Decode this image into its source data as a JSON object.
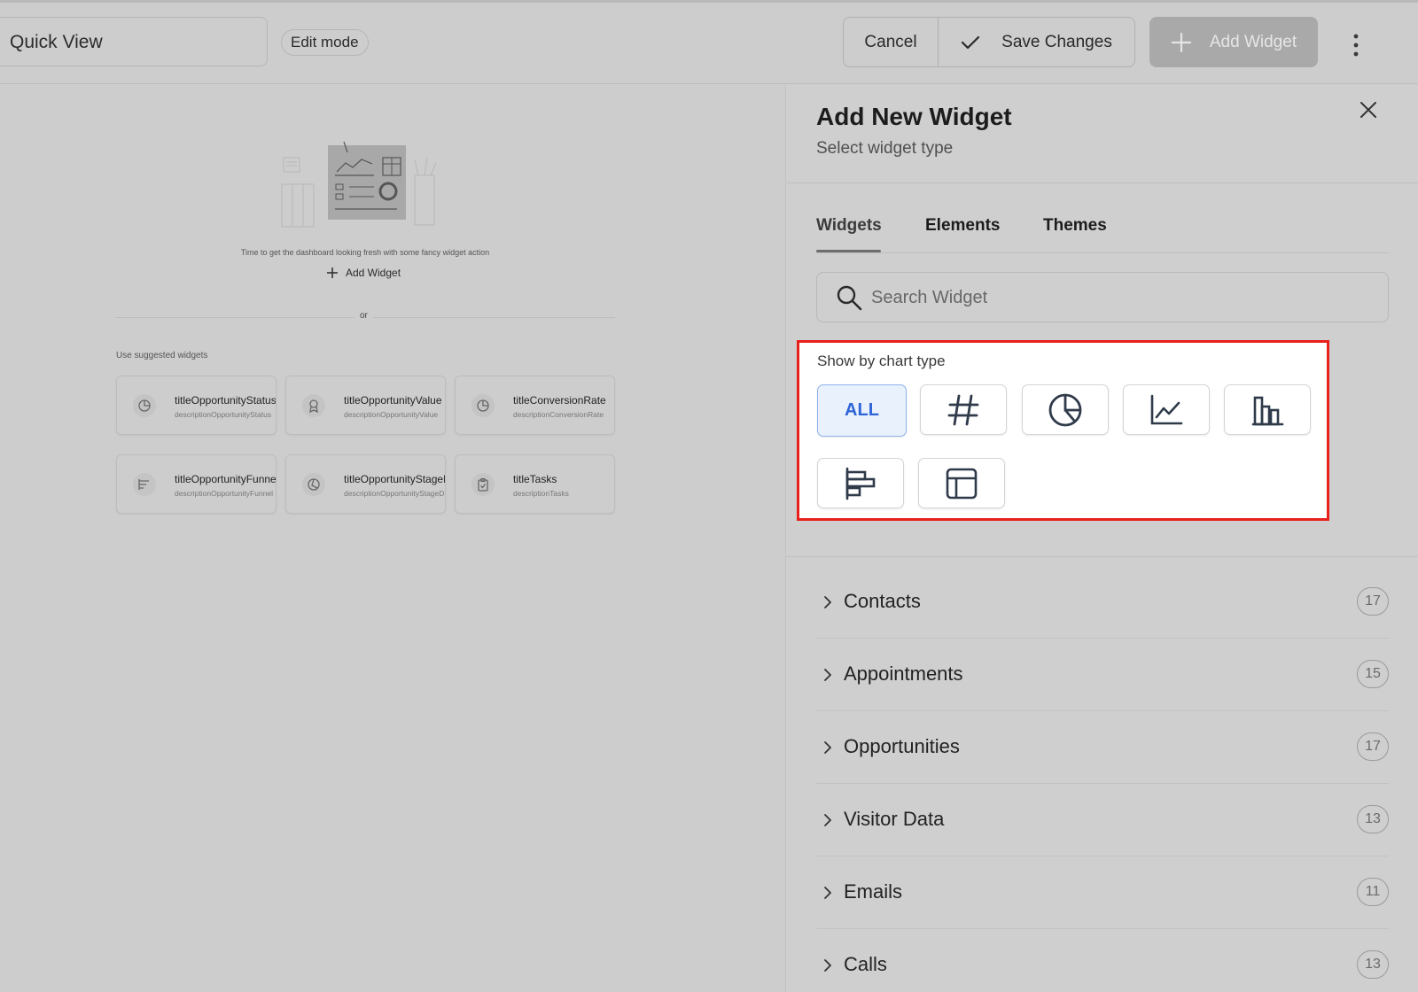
{
  "header": {
    "dashboard_name": "Quick View",
    "mode_badge": "Edit mode",
    "cancel_label": "Cancel",
    "save_label": "Save Changes",
    "add_widget_label": "Add Widget"
  },
  "canvas": {
    "empty_message": "Time to get the dashboard looking fresh with some fancy widget action",
    "add_widget_label": "Add Widget",
    "or_text": "or",
    "suggested_title": "Use suggested widgets",
    "suggested": [
      {
        "title": "titleOpportunityStatus",
        "description": "descriptionOpportunityStatus",
        "icon": "pie-chart-icon"
      },
      {
        "title": "titleOpportunityValue",
        "description": "descriptionOpportunityValue",
        "icon": "award-icon"
      },
      {
        "title": "titleConversionRate",
        "description": "descriptionConversionRate",
        "icon": "pie-chart-icon"
      },
      {
        "title": "titleOpportunityFunnel",
        "description": "descriptionOpportunityFunnel",
        "icon": "funnel-bars-icon"
      },
      {
        "title": "titleOpportunityStageD",
        "description": "descriptionOpportunityStageD",
        "icon": "circle-chart-icon"
      },
      {
        "title": "titleTasks",
        "description": "descriptionTasks",
        "icon": "clipboard-icon"
      }
    ]
  },
  "panel": {
    "title": "Add New Widget",
    "subtitle": "Select widget type",
    "tabs": [
      {
        "label": "Widgets",
        "active": true
      },
      {
        "label": "Elements",
        "active": false
      },
      {
        "label": "Themes",
        "active": false
      }
    ],
    "search_placeholder": "Search Widget",
    "chart_filter": {
      "label": "Show by chart type",
      "all_label": "ALL",
      "types": [
        "all",
        "number-hash-icon",
        "pie-chart-icon",
        "line-chart-icon",
        "bar-chart-icon",
        "horizontal-bar-chart-icon",
        "table-icon"
      ]
    },
    "categories": [
      {
        "name": "Contacts",
        "count": "17"
      },
      {
        "name": "Appointments",
        "count": "15"
      },
      {
        "name": "Opportunities",
        "count": "17"
      },
      {
        "name": "Visitor Data",
        "count": "13"
      },
      {
        "name": "Emails",
        "count": "11"
      },
      {
        "name": "Calls",
        "count": "13"
      }
    ]
  },
  "colors": {
    "accent_blue": "#2d64d8",
    "highlight_red": "#e8201b",
    "overlay_gray": "#cdcdcd"
  }
}
